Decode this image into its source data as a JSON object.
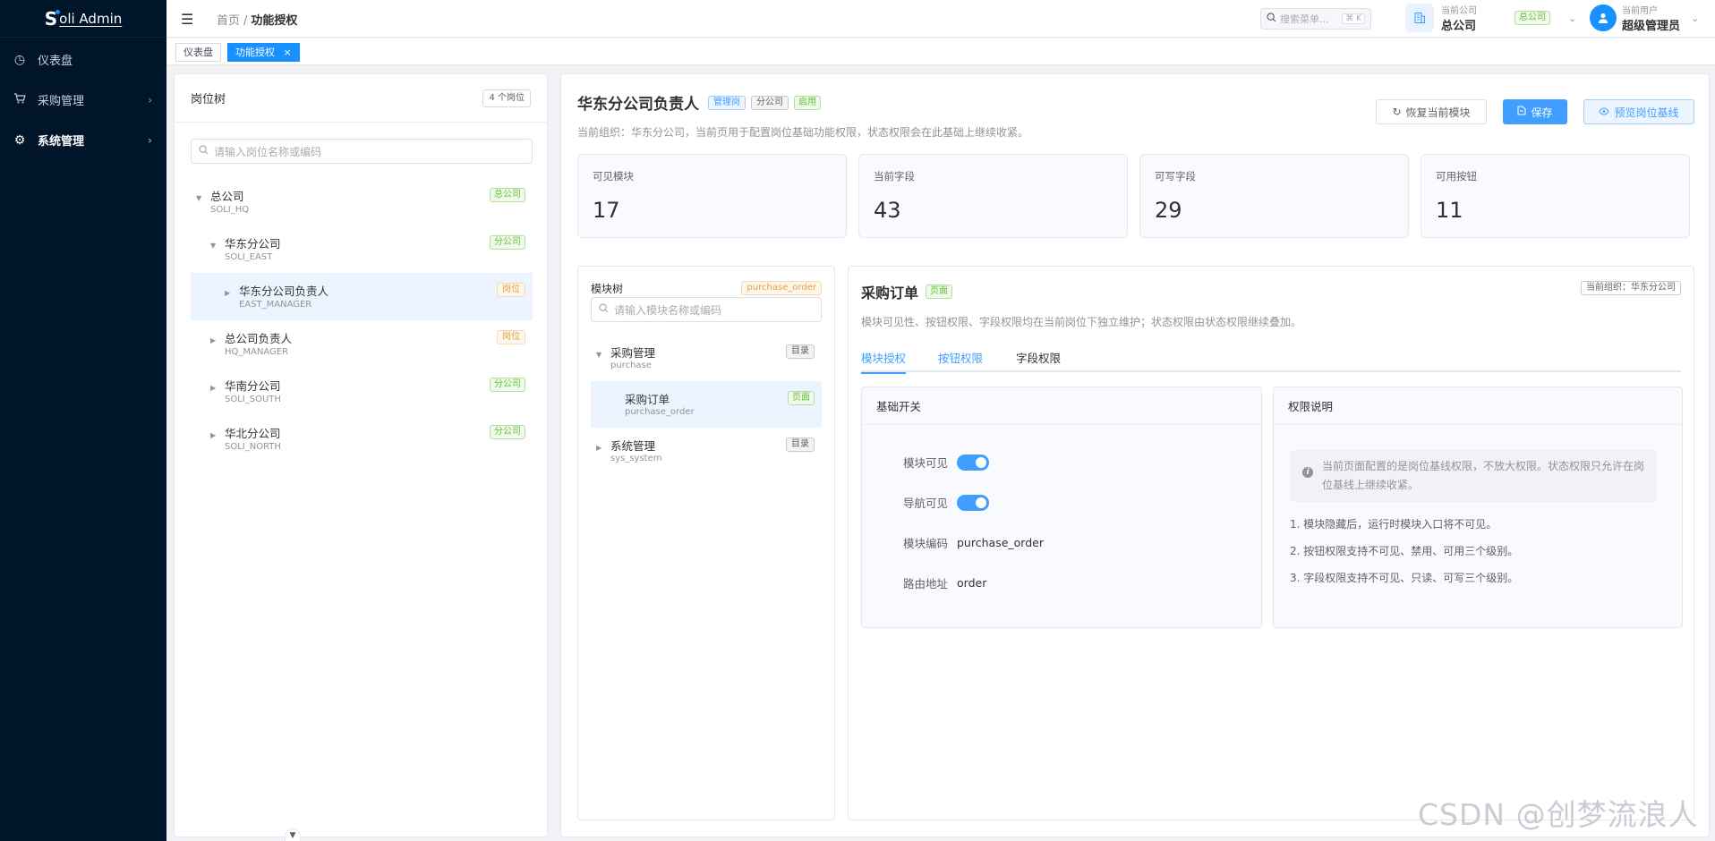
{
  "sidebar": {
    "logo_prefix": "S",
    "logo_text": "oli Admin",
    "items": [
      {
        "label": "仪表盘",
        "icon": "dashboard-icon",
        "glyph": "◷"
      },
      {
        "label": "采购管理",
        "icon": "cart-icon",
        "glyph": "🛒"
      },
      {
        "label": "系统管理",
        "icon": "gear-icon",
        "glyph": "⚙"
      }
    ]
  },
  "header": {
    "breadcrumb_home": "首页",
    "breadcrumb_sep": "/",
    "breadcrumb_current": "功能授权",
    "search_placeholder": "搜索菜单...",
    "search_shortcut": "⌘ K",
    "company_label": "当前公司",
    "company_name": "总公司",
    "company_tag": "总公司",
    "user_label": "当前用户",
    "user_name": "超级管理员"
  },
  "tabs": [
    {
      "label": "仪表盘",
      "active": false
    },
    {
      "label": "功能授权",
      "active": true,
      "close": "×"
    }
  ],
  "post_tree": {
    "title": "岗位树",
    "count_tag": "4 个岗位",
    "search_placeholder": "请输入岗位名称或编码",
    "nodes": [
      {
        "name": "总公司",
        "code": "SOLI_HQ",
        "tag": "总公司",
        "tag_color": "green",
        "level": 0,
        "expanded": true
      },
      {
        "name": "华东分公司",
        "code": "SOLI_EAST",
        "tag": "分公司",
        "tag_color": "green",
        "level": 1,
        "expanded": true
      },
      {
        "name": "华东分公司负责人",
        "code": "EAST_MANAGER",
        "tag": "岗位",
        "tag_color": "orange",
        "level": 2,
        "selected": true
      },
      {
        "name": "总公司负责人",
        "code": "HQ_MANAGER",
        "tag": "岗位",
        "tag_color": "orange",
        "level": 1
      },
      {
        "name": "华南分公司",
        "code": "SOLI_SOUTH",
        "tag": "分公司",
        "tag_color": "green",
        "level": 1
      },
      {
        "name": "华北分公司",
        "code": "SOLI_NORTH",
        "tag": "分公司",
        "tag_color": "green",
        "level": 1
      }
    ]
  },
  "role": {
    "name": "华东分公司负责人",
    "tags": [
      "管理岗",
      "分公司",
      "启用"
    ],
    "description": "当前组织：华东分公司，当前页用于配置岗位基础功能权限，状态权限会在此基础上继续收紧。",
    "btn_reset": "恢复当前模块",
    "btn_save": "保存",
    "btn_preview": "预览岗位基线"
  },
  "stats": [
    {
      "label": "可见模块",
      "value": "17"
    },
    {
      "label": "当前字段",
      "value": "43"
    },
    {
      "label": "可写字段",
      "value": "29"
    },
    {
      "label": "可用按钮",
      "value": "11"
    }
  ],
  "module_tree": {
    "title": "模块树",
    "current_code_tag": "purchase_order",
    "search_placeholder": "请输入模块名称或编码",
    "nodes": [
      {
        "name": "采购管理",
        "code": "purchase",
        "tag": "目录",
        "level": 0,
        "expanded": true
      },
      {
        "name": "采购订单",
        "code": "purchase_order",
        "tag": "页面",
        "level": 1,
        "selected": true
      },
      {
        "name": "系统管理",
        "code": "sys_system",
        "tag": "目录",
        "level": 0
      }
    ]
  },
  "module_detail": {
    "title": "采购订单",
    "title_tag": "页面",
    "org_tag": "当前组织：华东分公司",
    "description": "模块可见性、按钮权限、字段权限均在当前岗位下独立维护；状态权限由状态权限继续叠加。",
    "tabs": [
      "模块授权",
      "按钮权限",
      "字段权限"
    ],
    "basic_card_title": "基础开关",
    "fields": {
      "module_visible_label": "模块可见",
      "module_visible": true,
      "nav_visible_label": "导航可见",
      "nav_visible": true,
      "module_code_label": "模块编码",
      "module_code": "purchase_order",
      "route_label": "路由地址",
      "route": "order"
    },
    "explain_card_title": "权限说明",
    "alert": "当前页面配置的是岗位基线权限，不放大权限。状态权限只允许在岗位基线上继续收紧。",
    "notes": [
      "1. 模块隐藏后，运行时模块入口将不可见。",
      "2. 按钮权限支持不可见、禁用、可用三个级别。",
      "3. 字段权限支持不可见、只读、可写三个级别。"
    ]
  },
  "watermark": "CSDN @创梦流浪人",
  "colors": {
    "primary": "#409eff",
    "sidebar_bg": "#001529",
    "success": "#67c23a",
    "warning": "#e6a23c"
  }
}
